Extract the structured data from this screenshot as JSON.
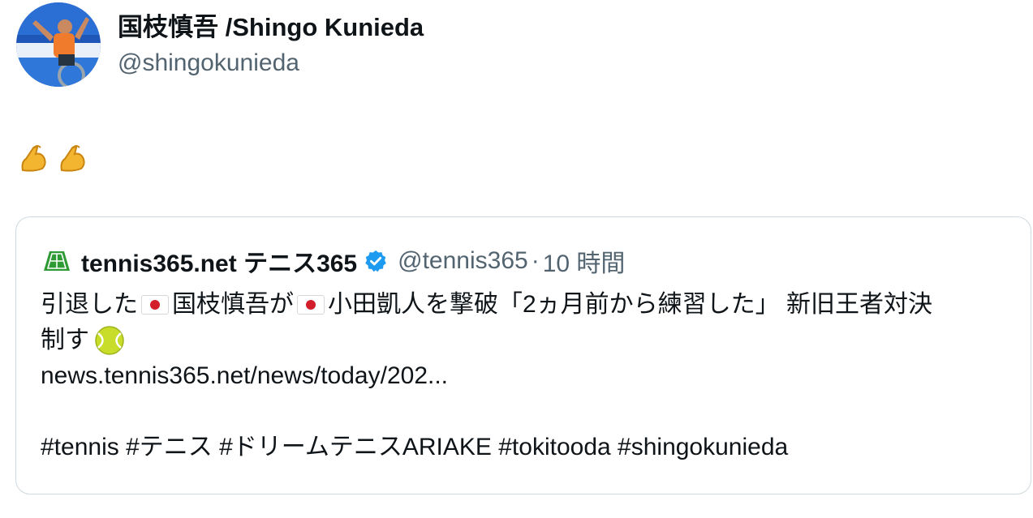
{
  "author": {
    "name": "国枝慎吾 /Shingo Kunieda",
    "handle": "@shingokunieda"
  },
  "tweet": {
    "emojis": [
      "flexed-biceps-icon",
      "flexed-biceps-icon"
    ]
  },
  "quote": {
    "name": "tennis365.net テニス365",
    "handle": "@tennis365",
    "separator": "·",
    "time": "10 時間",
    "line1_a": "引退した",
    "line1_b": "国枝慎吾が",
    "line1_c": "小田凱人を撃破「2ヵ月前から練習した」 新旧王者対決",
    "line2": "制す",
    "link": "news.tennis365.net/news/today/202...",
    "hashtags": "#tennis #テニス #ドリームテニスARIAKE #tokitooda #shingokunieda",
    "colors": {
      "verified": "#1d9bf0",
      "secondary": "#536471",
      "border": "#cfd9de",
      "logo": "#2e9b34"
    }
  }
}
